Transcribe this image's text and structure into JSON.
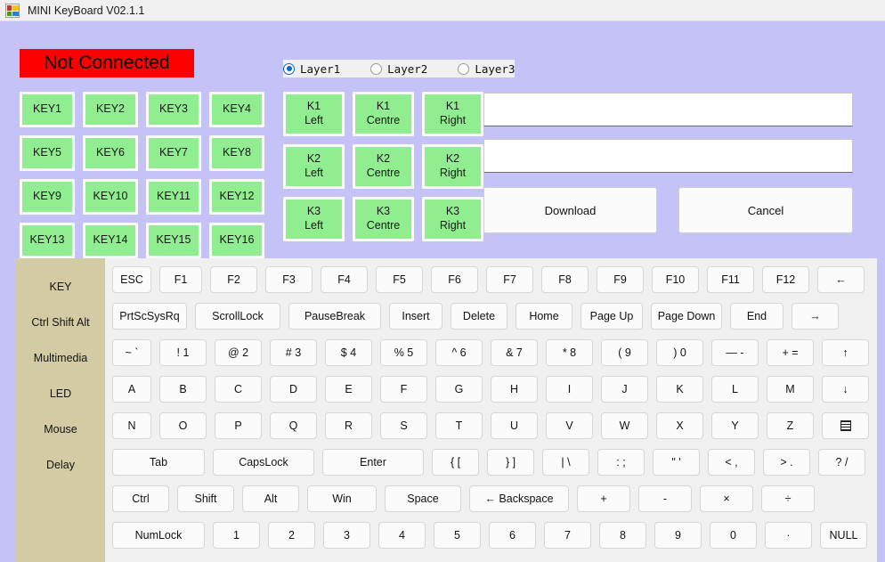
{
  "titlebar": {
    "icon": "app-window-icon",
    "title": "MINI KeyBoard V02.1.1"
  },
  "status": {
    "label": "Not Connected",
    "background_color": "#ff0000",
    "text_color": "#000000"
  },
  "layers": {
    "options": [
      {
        "label": "Layer1",
        "checked": true
      },
      {
        "label": "Layer2",
        "checked": false
      },
      {
        "label": "Layer3",
        "checked": false
      }
    ]
  },
  "macro_keys": {
    "items": [
      "KEY1",
      "KEY2",
      "KEY3",
      "KEY4",
      "KEY5",
      "KEY6",
      "KEY7",
      "KEY8",
      "KEY9",
      "KEY10",
      "KEY11",
      "KEY12",
      "KEY13",
      "KEY14",
      "KEY15",
      "KEY16"
    ],
    "color": "#90ee90"
  },
  "knob_keys": {
    "items": [
      {
        "line1": "K1",
        "line2": "Left"
      },
      {
        "line1": "K1",
        "line2": "Centre"
      },
      {
        "line1": "K1",
        "line2": "Right"
      },
      {
        "line1": "K2",
        "line2": "Left"
      },
      {
        "line1": "K2",
        "line2": "Centre"
      },
      {
        "line1": "K2",
        "line2": "Right"
      },
      {
        "line1": "K3",
        "line2": "Left"
      },
      {
        "line1": "K3",
        "line2": "Centre"
      },
      {
        "line1": "K3",
        "line2": "Right"
      }
    ],
    "color": "#90ee90"
  },
  "fields": {
    "field1_value": "",
    "field2_value": ""
  },
  "actions": {
    "download_label": "Download",
    "cancel_label": "Cancel"
  },
  "categories": {
    "items": [
      "KEY",
      "Ctrl Shift Alt",
      "Multimedia",
      "LED",
      "Mouse",
      "Delay"
    ],
    "background_color": "#d2cba4"
  },
  "keyboard": {
    "rows": [
      {
        "keys": [
          {
            "label": "ESC",
            "w": "w44"
          },
          {
            "label": "F1",
            "w": "w48"
          },
          {
            "label": "F2",
            "w": "w53"
          },
          {
            "label": "F3",
            "w": "w53"
          },
          {
            "label": "F4",
            "w": "w53"
          },
          {
            "label": "F5",
            "w": "w53"
          },
          {
            "label": "F6",
            "w": "w53"
          },
          {
            "label": "F7",
            "w": "w53"
          },
          {
            "label": "F8",
            "w": "w53"
          },
          {
            "label": "F9",
            "w": "w53"
          },
          {
            "label": "F10",
            "w": "w53"
          },
          {
            "label": "F11",
            "w": "w53"
          },
          {
            "label": "F12",
            "w": "w53"
          },
          {
            "label": "←",
            "w": "w53"
          }
        ]
      },
      {
        "keys": [
          {
            "label": "PrtScSysRq",
            "w": "w84"
          },
          {
            "label": "ScrollLock",
            "w": "w96"
          },
          {
            "label": "PauseBreak",
            "w": "w104"
          },
          {
            "label": "Insert",
            "w": "w60"
          },
          {
            "label": "Delete",
            "w": "w64"
          },
          {
            "label": "Home",
            "w": "w64"
          },
          {
            "label": "Page Up",
            "w": "w70"
          },
          {
            "label": "Page Down",
            "w": "w80"
          },
          {
            "label": "End",
            "w": "w60"
          },
          {
            "label": "→",
            "w": "w53"
          }
        ]
      },
      {
        "keys": [
          {
            "label": "~ `",
            "w": "w44"
          },
          {
            "label": "! 1",
            "w": "w53"
          },
          {
            "label": "@ 2",
            "w": "w53"
          },
          {
            "label": "# 3",
            "w": "w53"
          },
          {
            "label": "$ 4",
            "w": "w53"
          },
          {
            "label": "% 5",
            "w": "w53"
          },
          {
            "label": "^ 6",
            "w": "w53"
          },
          {
            "label": "& 7",
            "w": "w53"
          },
          {
            "label": "* 8",
            "w": "w53"
          },
          {
            "label": "( 9",
            "w": "w53"
          },
          {
            "label": ") 0",
            "w": "w53"
          },
          {
            "label": "— -",
            "w": "w53"
          },
          {
            "label": "+ =",
            "w": "w53"
          },
          {
            "label": "↑",
            "w": "w53"
          }
        ]
      },
      {
        "keys": [
          {
            "label": "A",
            "w": "w44"
          },
          {
            "label": "B",
            "w": "w53"
          },
          {
            "label": "C",
            "w": "w53"
          },
          {
            "label": "D",
            "w": "w53"
          },
          {
            "label": "E",
            "w": "w53"
          },
          {
            "label": "F",
            "w": "w53"
          },
          {
            "label": "G",
            "w": "w53"
          },
          {
            "label": "H",
            "w": "w53"
          },
          {
            "label": "I",
            "w": "w53"
          },
          {
            "label": "J",
            "w": "w53"
          },
          {
            "label": "K",
            "w": "w53"
          },
          {
            "label": "L",
            "w": "w53"
          },
          {
            "label": "M",
            "w": "w53"
          },
          {
            "label": "↓",
            "w": "w53"
          }
        ]
      },
      {
        "keys": [
          {
            "label": "N",
            "w": "w44"
          },
          {
            "label": "O",
            "w": "w53"
          },
          {
            "label": "P",
            "w": "w53"
          },
          {
            "label": "Q",
            "w": "w53"
          },
          {
            "label": "R",
            "w": "w53"
          },
          {
            "label": "S",
            "w": "w53"
          },
          {
            "label": "T",
            "w": "w53"
          },
          {
            "label": "U",
            "w": "w53"
          },
          {
            "label": "V",
            "w": "w53"
          },
          {
            "label": "W",
            "w": "w53"
          },
          {
            "label": "X",
            "w": "w53"
          },
          {
            "label": "Y",
            "w": "w53"
          },
          {
            "label": "Z",
            "w": "w53"
          },
          {
            "label": "menu-icon",
            "w": "w53",
            "icon": "menu-icon"
          }
        ]
      },
      {
        "keys": [
          {
            "label": "Tab",
            "w": "w104"
          },
          {
            "label": "CapsLock",
            "w": "w114"
          },
          {
            "label": "Enter",
            "w": "w114"
          },
          {
            "label": "{ [",
            "w": "w53"
          },
          {
            "label": "} ]",
            "w": "w53"
          },
          {
            "label": "| \\",
            "w": "w53"
          },
          {
            "label": ": ;",
            "w": "w53"
          },
          {
            "label": "\" '",
            "w": "w53"
          },
          {
            "label": "< ,",
            "w": "w53"
          },
          {
            "label": "> .",
            "w": "w53"
          },
          {
            "label": "? /",
            "w": "w53"
          }
        ]
      },
      {
        "keys": [
          {
            "label": "Ctrl",
            "w": "w64"
          },
          {
            "label": "Shift",
            "w": "w64"
          },
          {
            "label": "Alt",
            "w": "w64"
          },
          {
            "label": "Win",
            "w": "w78"
          },
          {
            "label": "Space",
            "w": "w86"
          },
          {
            "label": "← Backspace",
            "w": "w112"
          },
          {
            "label": "+",
            "w": "w60"
          },
          {
            "label": "-",
            "w": "w60"
          },
          {
            "label": "×",
            "w": "w60"
          },
          {
            "label": "÷",
            "w": "w60"
          }
        ]
      },
      {
        "keys": [
          {
            "label": "NumLock",
            "w": "w104"
          },
          {
            "label": "1",
            "w": "w53"
          },
          {
            "label": "2",
            "w": "w53"
          },
          {
            "label": "3",
            "w": "w53"
          },
          {
            "label": "4",
            "w": "w53"
          },
          {
            "label": "5",
            "w": "w53"
          },
          {
            "label": "6",
            "w": "w53"
          },
          {
            "label": "7",
            "w": "w53"
          },
          {
            "label": "8",
            "w": "w53"
          },
          {
            "label": "9",
            "w": "w53"
          },
          {
            "label": "0",
            "w": "w53"
          },
          {
            "label": "·",
            "w": "w53"
          },
          {
            "label": "NULL",
            "w": "w53"
          }
        ]
      }
    ]
  }
}
